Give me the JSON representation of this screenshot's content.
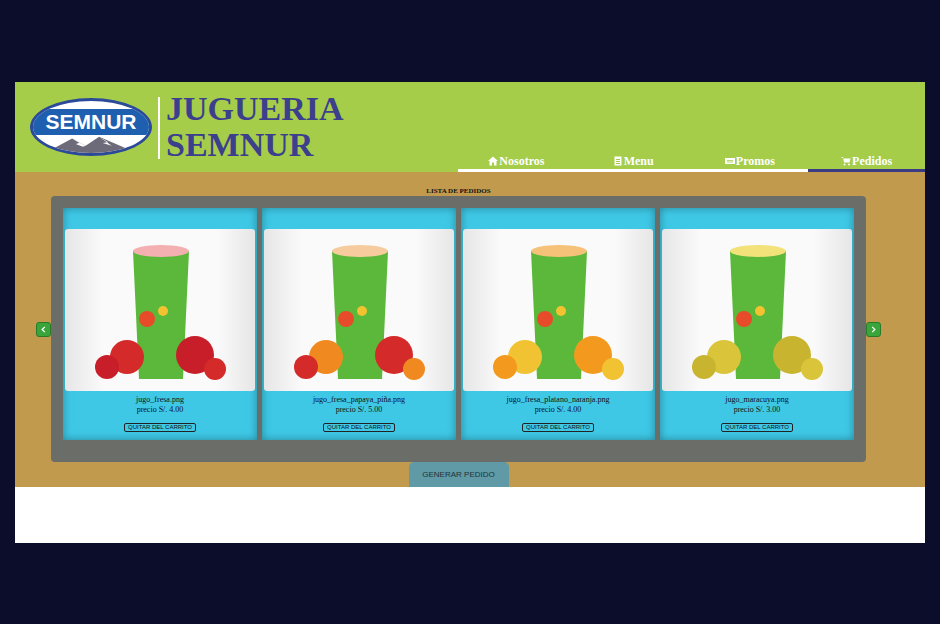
{
  "brand": {
    "logo": "SEMNUR",
    "title_line1": "JUGUERIA",
    "title_line2": "SEMNUR"
  },
  "nav": [
    {
      "label": "Nosotros",
      "selected": false
    },
    {
      "label": "Menu",
      "selected": false
    },
    {
      "label": "Promos",
      "selected": false
    },
    {
      "label": "Pedidos",
      "selected": true
    }
  ],
  "section_title": "LISTA DE PEDIDOS",
  "items": [
    {
      "name": "jugo_fresa.png",
      "price": "precio S/. 4.00",
      "button": "QUITAR DEL CARRITO"
    },
    {
      "name": "jugo_fresa_papaya_piña.png",
      "price": "precio S/. 5.00",
      "button": "QUITAR DEL CARRITO"
    },
    {
      "name": "jugo_fresa_platano_naranja.png",
      "price": "precio S/. 4.00",
      "button": "QUITAR DEL CARRITO"
    },
    {
      "name": "jugo_maracuya.png",
      "price": "precio S/. 3.00",
      "button": "QUITAR DEL CARRITO"
    }
  ],
  "order_button": "GENERAR PEDIDO"
}
